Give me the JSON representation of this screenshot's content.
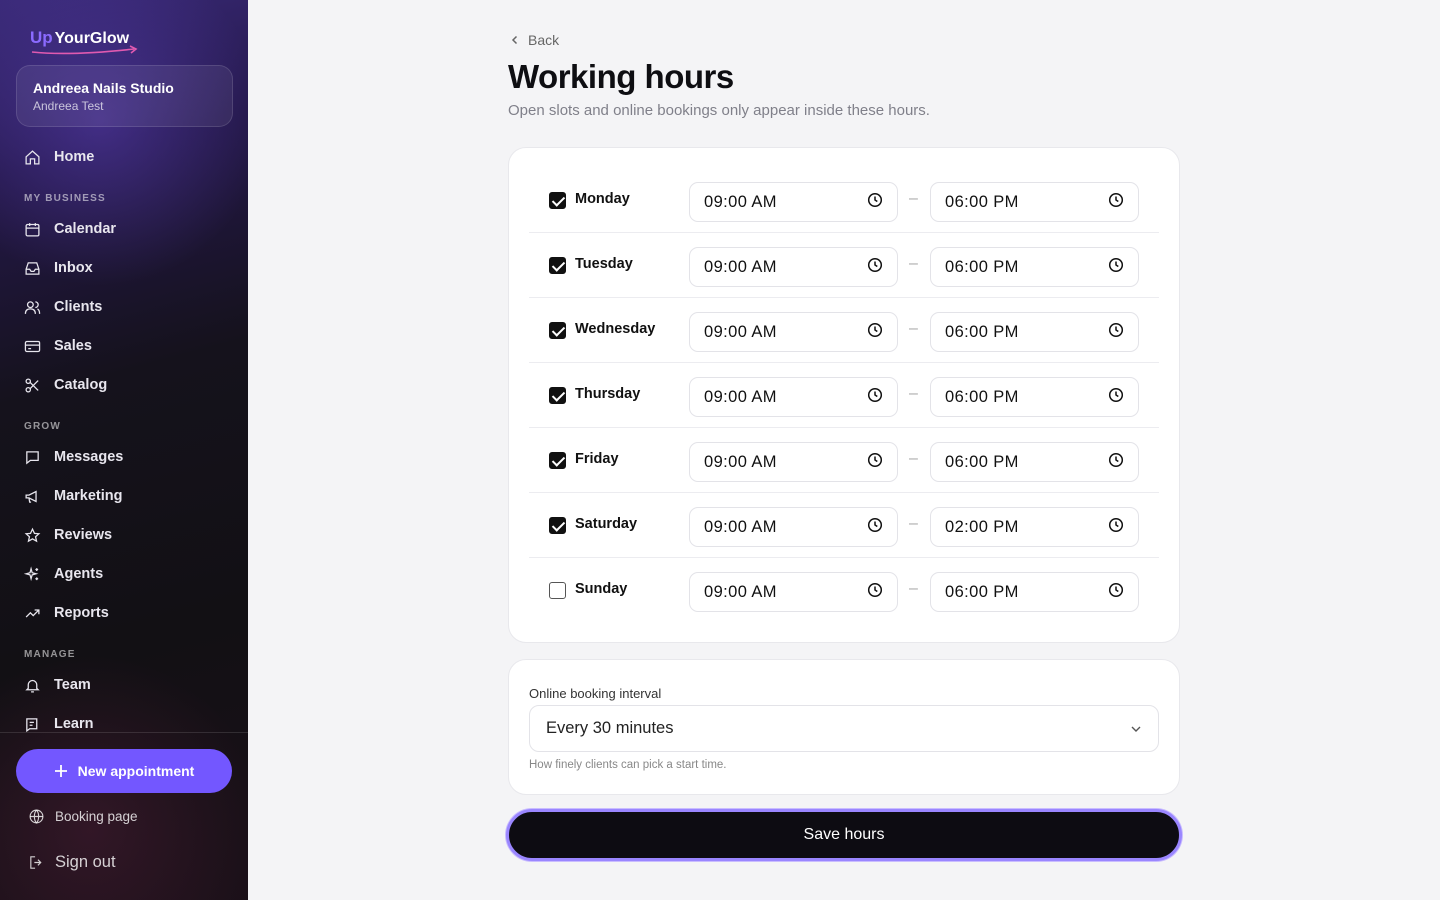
{
  "brand": {
    "up": "Up",
    "name": "YourGlow"
  },
  "studio": {
    "name": "Andreea Nails Studio",
    "user": "Andreea Test"
  },
  "nav": {
    "home": "Home",
    "sections": {
      "my_business": "MY BUSINESS",
      "grow": "GROW",
      "manage": "MANAGE"
    },
    "calendar": "Calendar",
    "inbox": "Inbox",
    "clients": "Clients",
    "sales": "Sales",
    "catalog": "Catalog",
    "messages": "Messages",
    "marketing": "Marketing",
    "reviews": "Reviews",
    "agents": "Agents",
    "reports": "Reports",
    "team": "Team",
    "learn": "Learn"
  },
  "sidebar_actions": {
    "new_appointment": "New appointment",
    "booking_page": "Booking page",
    "sign_out": "Sign out"
  },
  "page": {
    "back": "Back",
    "title": "Working hours",
    "subtitle": "Open slots and online bookings only appear inside these hours."
  },
  "days": [
    {
      "name": "Monday",
      "enabled": true,
      "start": "09:00 AM",
      "end": "06:00 PM"
    },
    {
      "name": "Tuesday",
      "enabled": true,
      "start": "09:00 AM",
      "end": "06:00 PM"
    },
    {
      "name": "Wednesday",
      "enabled": true,
      "start": "09:00 AM",
      "end": "06:00 PM"
    },
    {
      "name": "Thursday",
      "enabled": true,
      "start": "09:00 AM",
      "end": "06:00 PM"
    },
    {
      "name": "Friday",
      "enabled": true,
      "start": "09:00 AM",
      "end": "06:00 PM"
    },
    {
      "name": "Saturday",
      "enabled": true,
      "start": "09:00 AM",
      "end": "02:00 PM"
    },
    {
      "name": "Sunday",
      "enabled": false,
      "start": "09:00 AM",
      "end": "06:00 PM"
    }
  ],
  "separator": "–",
  "interval": {
    "label": "Online booking interval",
    "value": "Every 30 minutes",
    "help": "How finely clients can pick a start time."
  },
  "save_label": "Save hours",
  "colors": {
    "accent": "#7357ff",
    "button_dark": "#0d0c12",
    "focus_ring": "#9a86ff"
  }
}
